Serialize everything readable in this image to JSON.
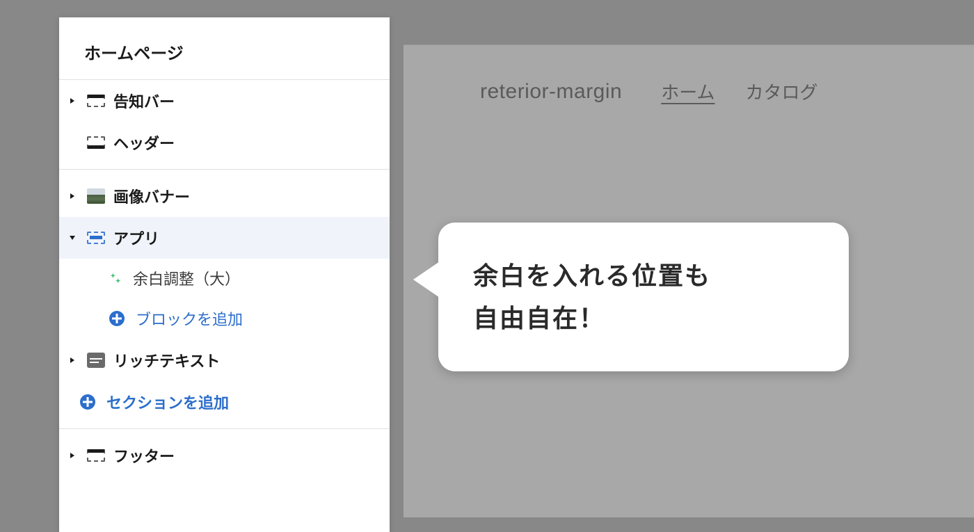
{
  "sidebar": {
    "title": "ホームページ",
    "sections": {
      "announcement": {
        "label": "告知バー"
      },
      "header": {
        "label": "ヘッダー"
      },
      "imageBanner": {
        "label": "画像バナー"
      },
      "app": {
        "label": "アプリ",
        "blocks": {
          "marginAdjust": {
            "label": "余白調整（大）"
          }
        },
        "addBlock": {
          "label": "ブロックを追加"
        }
      },
      "richText": {
        "label": "リッチテキスト"
      },
      "addSection": {
        "label": "セクションを追加"
      },
      "footer": {
        "label": "フッター"
      }
    }
  },
  "preview": {
    "logo": "reterior-margin",
    "nav": {
      "home": "ホーム",
      "catalog": "カタログ"
    }
  },
  "callout": {
    "line1": "余白を入れる位置も",
    "line2": "自由自在！"
  }
}
